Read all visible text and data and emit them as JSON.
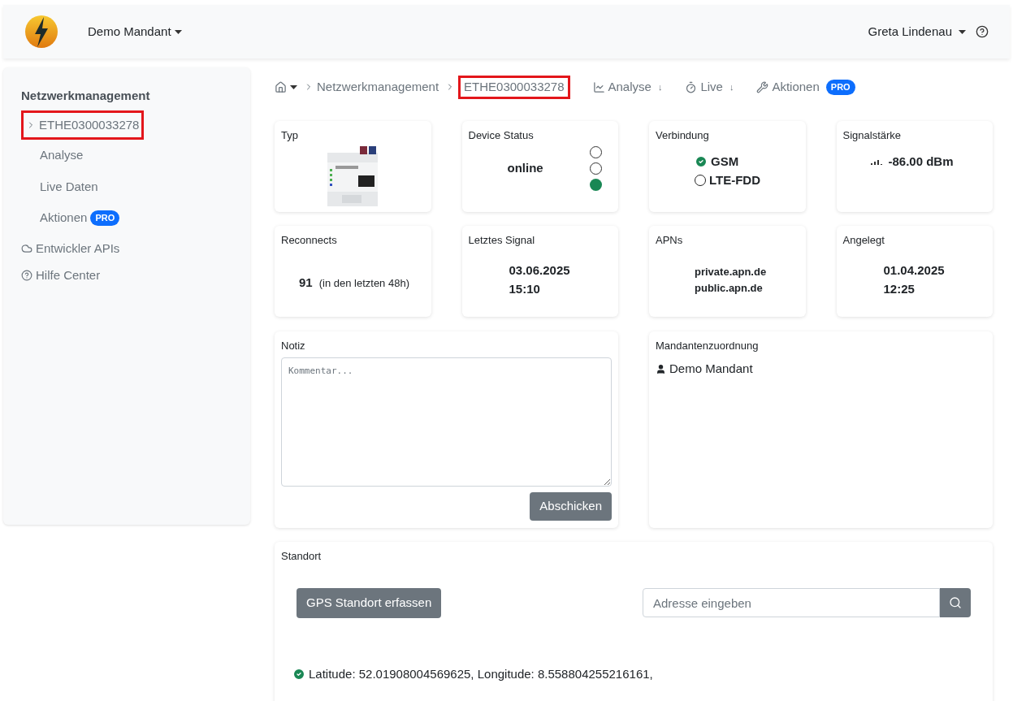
{
  "header": {
    "tenant": "Demo Mandant",
    "user": "Greta Lindenau"
  },
  "sidebar": {
    "title": "Netzwerkmanagement",
    "items": [
      {
        "kind": "device",
        "label": "ETHE0300033278",
        "highlighted": true,
        "children": [
          {
            "label": "Analyse"
          },
          {
            "label": "Live Daten"
          },
          {
            "label": "Aktionen",
            "badge": "PRO"
          }
        ]
      },
      {
        "kind": "cloud",
        "label": "Entwickler APIs",
        "highlighted": false
      },
      {
        "kind": "help",
        "label": "Hilfe Center",
        "highlighted": false
      }
    ]
  },
  "breadcrumb": {
    "items": [
      {
        "label": "Netzwerkmanagement",
        "highlighted": false
      },
      {
        "label": "ETHE0300033278",
        "highlighted": true
      }
    ],
    "actions": [
      {
        "kind": "chart",
        "label": "Analyse",
        "arrow": "↓"
      },
      {
        "kind": "timer",
        "label": "Live",
        "arrow": "↓"
      },
      {
        "kind": "wrench",
        "label": "Aktionen",
        "badge": "PRO"
      }
    ]
  },
  "cards": [
    {
      "kind": "picture",
      "title": "Typ"
    },
    {
      "kind": "status",
      "title": "Device Status",
      "value": "online",
      "lights": [
        {
          "on": false
        },
        {
          "on": false
        },
        {
          "on": true
        }
      ]
    },
    {
      "kind": "connection",
      "title": "Verbindung",
      "options": [
        {
          "label": "GSM",
          "selected": true
        },
        {
          "label": "LTE-FDD",
          "selected": false
        }
      ]
    },
    {
      "kind": "signal",
      "title": "Signalstärke",
      "value": "-86.00 dBm"
    },
    {
      "kind": "count",
      "title": "Reconnects",
      "value": "91",
      "note": "(in den letzten 48h)"
    },
    {
      "kind": "lines",
      "title": "Letztes Signal",
      "lines": [
        "03.06.2025",
        "15:10"
      ]
    },
    {
      "kind": "small-lines",
      "title": "APNs",
      "lines": [
        "private.apn.de",
        "public.apn.de"
      ]
    },
    {
      "kind": "lines",
      "title": "Angelegt",
      "lines": [
        "01.04.2025",
        "12:25"
      ]
    }
  ],
  "note": {
    "title": "Notiz",
    "placeholder": "Kommentar...",
    "button": "Abschicken"
  },
  "tenant_assignment": {
    "title": "Mandantenzuordnung",
    "tenant": "Demo Mandant"
  },
  "location": {
    "title": "Standort",
    "gps_button": "GPS Standort erfassen",
    "address_placeholder": "Adresse eingeben",
    "result": "Latitude: 52.01908004569625, Longitude: 8.558804255216161,"
  }
}
